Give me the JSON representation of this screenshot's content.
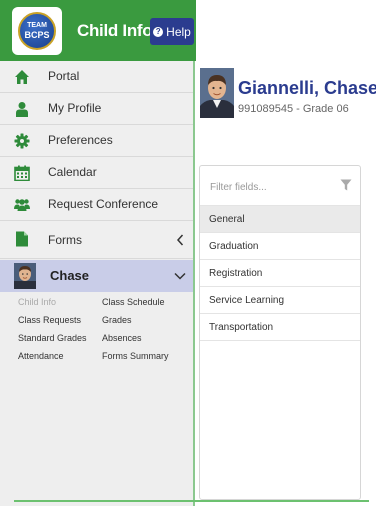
{
  "header": {
    "logo_top": "TEAM",
    "logo_bottom": "BCPS",
    "title": "Child Info",
    "help_label": "Help"
  },
  "sidebar": {
    "items": [
      {
        "label": "Portal",
        "icon": "home-icon"
      },
      {
        "label": "My Profile",
        "icon": "person-icon"
      },
      {
        "label": "Preferences",
        "icon": "gear-icon"
      },
      {
        "label": "Calendar",
        "icon": "calendar-icon"
      },
      {
        "label": "Request Conference",
        "icon": "group-icon"
      },
      {
        "label": "Forms",
        "icon": "document-icon"
      }
    ],
    "child": {
      "name": "Chase"
    },
    "sub_links": [
      {
        "label": "Child Info"
      },
      {
        "label": "Class Schedule"
      },
      {
        "label": "Class Requests"
      },
      {
        "label": "Grades"
      },
      {
        "label": "Standard Grades"
      },
      {
        "label": "Absences"
      },
      {
        "label": "Attendance"
      },
      {
        "label": "Forms Summary"
      }
    ]
  },
  "student": {
    "name": "Giannelli, Chase",
    "id_grade": "991089545 - Grade 06"
  },
  "fields_panel": {
    "filter_placeholder": "Filter fields...",
    "items": [
      {
        "label": "General"
      },
      {
        "label": "Graduation"
      },
      {
        "label": "Registration"
      },
      {
        "label": "Service Learning"
      },
      {
        "label": "Transportation"
      }
    ]
  },
  "colors": {
    "brand_green": "#3a9a3f",
    "help_blue": "#2b3c8f",
    "name_blue": "#2b3c8f",
    "selected_child": "#c9cde8"
  }
}
